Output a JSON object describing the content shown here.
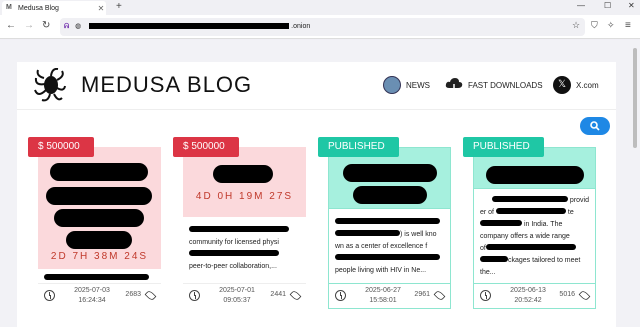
{
  "browser": {
    "tab_title": "Medusa Blog",
    "tab_favicon": "M",
    "url_suffix": ".onion",
    "new_tab": "+",
    "controls": {
      "minimize": "—",
      "maximize": "☐",
      "close": "✕"
    }
  },
  "header": {
    "brand": "MEDUSA BLOG",
    "nav": [
      {
        "label": "NEWS",
        "icon": "news-avatar-icon"
      },
      {
        "label": "FAST DOWNLOADS",
        "icon": "cloud-download-icon"
      },
      {
        "label": "X.com",
        "icon": "x-logo-icon"
      }
    ]
  },
  "cards": [
    {
      "badge": "$ 500000",
      "badge_color": "#dc3545",
      "top_bg": "#fbd9dc",
      "countdown": "2D 7H 38M 24S",
      "excerpt": [],
      "date": "2025-07-03",
      "time": "16:24:34",
      "views": "2683"
    },
    {
      "badge": "$ 500000",
      "badge_color": "#dc3545",
      "top_bg": "#fbd9dc",
      "countdown": "4D 0H 19M 27S",
      "excerpt": [
        "community for licensed physi",
        "peer-to-peer collaboration,..."
      ],
      "date": "2025-07-01",
      "time": "09:05:37",
      "views": "2441"
    },
    {
      "badge": "PUBLISHED",
      "badge_color": "#1fc7a5",
      "top_bg": "#a6f0de",
      "countdown": "",
      "excerpt": [
        ") is well kno",
        "wn as a center of excellence f",
        "people living with HIV in Ne..."
      ],
      "date": "2025-06-27",
      "time": "15:58:01",
      "views": "2961"
    },
    {
      "badge": "PUBLISHED",
      "badge_color": "#1fc7a5",
      "top_bg": "#a6f0de",
      "countdown": "",
      "excerpt": [
        "provid",
        "er of",
        "te",
        "in India. The",
        "company offers a wide range",
        "of",
        "ckages tailored to meet the..."
      ],
      "date": "2025-06-13",
      "time": "20:52:42",
      "views": "5016"
    }
  ],
  "colors": {
    "accent": "#1e88e5",
    "red": "#dc3545",
    "green": "#1fc7a5"
  }
}
